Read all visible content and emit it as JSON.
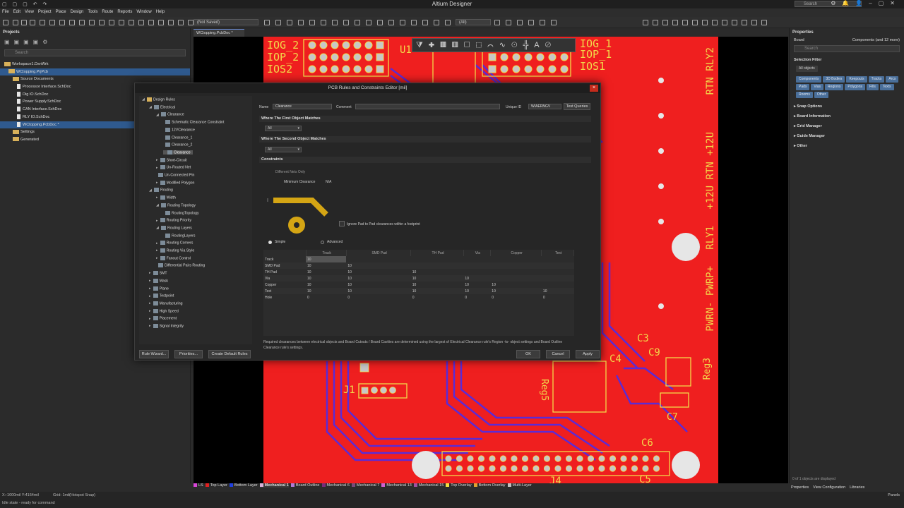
{
  "app": {
    "title": "Altium Designer",
    "search_placeholder": "Search"
  },
  "menu": [
    "File",
    "Edit",
    "View",
    "Project",
    "Place",
    "Design",
    "Tools",
    "Route",
    "Reports",
    "Window",
    "Help"
  ],
  "toolbar": {
    "saved_state": "(Not Saved)",
    "filter_value": "(All)"
  },
  "projects_panel": {
    "title": "Projects",
    "search_placeholder": "Search",
    "tree": [
      {
        "label": "Workspace1.DsnWrk",
        "indent": 0,
        "type": "workspace"
      },
      {
        "label": "WCtopping.PrjPcb",
        "indent": 1,
        "type": "project",
        "selected": true
      },
      {
        "label": "Source Documents",
        "indent": 2,
        "type": "folder"
      },
      {
        "label": "Processor Interface.SchDoc",
        "indent": 3,
        "type": "doc"
      },
      {
        "label": "Dig IO.SchDoc",
        "indent": 3,
        "type": "doc"
      },
      {
        "label": "Power Supply.SchDoc",
        "indent": 3,
        "type": "doc"
      },
      {
        "label": "CAN Interface.SchDoc",
        "indent": 3,
        "type": "doc"
      },
      {
        "label": "RLY IO.SchDoc",
        "indent": 3,
        "type": "doc"
      },
      {
        "label": "WCtopping.PcbDoc *",
        "indent": 3,
        "type": "doc",
        "selected": true
      },
      {
        "label": "Settings",
        "indent": 2,
        "type": "folder"
      },
      {
        "label": "Generated",
        "indent": 2,
        "type": "folder"
      }
    ]
  },
  "doc_tab": "WCtopping.PcbDoc *",
  "pcb_labels": {
    "iog2": "IOG_2",
    "iop2": "IOP_2",
    "ios2": "IOS2",
    "iog1": "IOG_1",
    "iop1": "IOP_1",
    "ios1": "IOS1",
    "u1": "U1",
    "rly2": "RTN RLY2",
    "p12": "+12U RTN +12U",
    "rly1": "RLY1",
    "pwrn": "PWRN- PWRP+",
    "c3": "C3",
    "c9": "C9",
    "c4": "C4",
    "reg3": "Reg3",
    "reg5": "Reg5",
    "c7": "C7",
    "j1": "J1",
    "c6": "C6",
    "c5": "C5",
    "j4": "J4"
  },
  "properties_panel": {
    "title": "Properties",
    "board_label": "Board",
    "components_info": "Components (and 12 more)",
    "search_placeholder": "Search",
    "selection_filter": "Selection Filter",
    "all_objects": "All objects",
    "filters": [
      "Components",
      "3D Bodies",
      "Keepouts",
      "Tracks",
      "Arcs",
      "Pads",
      "Vias",
      "Regions",
      "Polygons",
      "Fills",
      "Texts",
      "Rooms",
      "Other"
    ],
    "sections": [
      "Snap Options",
      "Board Information",
      "Grid Manager",
      "Guide Manager",
      "Other"
    ],
    "selection_status": "0 of 1 objects are displayed",
    "bottom_tabs": [
      "Properties",
      "View Configuration",
      "Libraries"
    ]
  },
  "dialog": {
    "title": "PCB Rules and Constraints Editor [mil]",
    "close": "×",
    "tree": [
      {
        "label": "Design Rules",
        "lvl": 0,
        "arrow": "◢"
      },
      {
        "label": "Electrical",
        "lvl": 1,
        "arrow": "◢"
      },
      {
        "label": "Clearance",
        "lvl": 2,
        "arrow": "◢"
      },
      {
        "label": "Schematic Clearance Constraint",
        "lvl": 3,
        "arrow": ""
      },
      {
        "label": "12VClearance",
        "lvl": 3,
        "arrow": ""
      },
      {
        "label": "Clearance_1",
        "lvl": 3,
        "arrow": ""
      },
      {
        "label": "Clearance_2",
        "lvl": 3,
        "arrow": ""
      },
      {
        "label": "Clearance",
        "lvl": 3,
        "arrow": "",
        "selected": true
      },
      {
        "label": "Short-Circuit",
        "lvl": 2,
        "arrow": "▸"
      },
      {
        "label": "Un-Routed Net",
        "lvl": 2,
        "arrow": "▸"
      },
      {
        "label": "Un-Connected Pin",
        "lvl": 2,
        "arrow": ""
      },
      {
        "label": "Modified Polygon",
        "lvl": 2,
        "arrow": "▸"
      },
      {
        "label": "Routing",
        "lvl": 1,
        "arrow": "◢"
      },
      {
        "label": "Width",
        "lvl": 2,
        "arrow": "▸"
      },
      {
        "label": "Routing Topology",
        "lvl": 2,
        "arrow": "◢"
      },
      {
        "label": "RoutingTopology",
        "lvl": 3,
        "arrow": ""
      },
      {
        "label": "Routing Priority",
        "lvl": 2,
        "arrow": "▸"
      },
      {
        "label": "Routing Layers",
        "lvl": 2,
        "arrow": "◢"
      },
      {
        "label": "RoutingLayers",
        "lvl": 3,
        "arrow": ""
      },
      {
        "label": "Routing Corners",
        "lvl": 2,
        "arrow": "▸"
      },
      {
        "label": "Routing Via Style",
        "lvl": 2,
        "arrow": "▸"
      },
      {
        "label": "Fanout Control",
        "lvl": 2,
        "arrow": "▸"
      },
      {
        "label": "Differential Pairs Routing",
        "lvl": 2,
        "arrow": ""
      },
      {
        "label": "SMT",
        "lvl": 1,
        "arrow": "▸"
      },
      {
        "label": "Mask",
        "lvl": 1,
        "arrow": "▸"
      },
      {
        "label": "Plane",
        "lvl": 1,
        "arrow": "▸"
      },
      {
        "label": "Testpoint",
        "lvl": 1,
        "arrow": "▸"
      },
      {
        "label": "Manufacturing",
        "lvl": 1,
        "arrow": "▸"
      },
      {
        "label": "High Speed",
        "lvl": 1,
        "arrow": "▸"
      },
      {
        "label": "Placement",
        "lvl": 1,
        "arrow": "▸"
      },
      {
        "label": "Signal Integrity",
        "lvl": 1,
        "arrow": "▸"
      }
    ],
    "name_label": "Name",
    "name_value": "Clearance",
    "comment_label": "Comment",
    "comment_value": "",
    "uid_label": "Unique ID",
    "uid_value": "WIAERNGV",
    "test_queries": "Test Queries",
    "first_match": "Where The First Object Matches",
    "first_value": "All",
    "second_match": "Where The Second Object Matches",
    "second_value": "All",
    "constraints": "Constraints",
    "different_nets": "Different Nets Only",
    "min_clearance": "Minimum Clearance",
    "min_clearance_value": "N/A",
    "ignore_pad": "Ignore Pad to Pad clearances within a footprint",
    "simple": "Simple",
    "advanced": "Advanced",
    "matrix_headers": [
      "Track",
      "SMD Pad",
      "TH Pad",
      "Via",
      "Copper",
      "Text"
    ],
    "matrix_rows": [
      {
        "name": "Track",
        "vals": [
          "10",
          "",
          "",
          "",
          "",
          ""
        ]
      },
      {
        "name": "SMD Pad",
        "vals": [
          "10",
          "10",
          "",
          "",
          "",
          ""
        ]
      },
      {
        "name": "TH Pad",
        "vals": [
          "10",
          "10",
          "10",
          "",
          "",
          ""
        ]
      },
      {
        "name": "Via",
        "vals": [
          "10",
          "10",
          "10",
          "10",
          "",
          ""
        ]
      },
      {
        "name": "Copper",
        "vals": [
          "10",
          "10",
          "10",
          "10",
          "10",
          ""
        ]
      },
      {
        "name": "Text",
        "vals": [
          "10",
          "10",
          "10",
          "10",
          "10",
          "10"
        ]
      },
      {
        "name": "Hole",
        "vals": [
          "0",
          "0",
          "0",
          "0",
          "0",
          "0"
        ]
      }
    ],
    "note": "Required clearances between electrical objects and Board Cutouts / Board Cavities are determined using the largest of Electrical Clearance rule's Region -to- object settings and Board Outline Clearance rule's settings.",
    "buttons": {
      "rule_wizard": "Rule Wizard...",
      "priorities": "Priorities...",
      "create_default": "Create Default Rules",
      "ok": "OK",
      "cancel": "Cancel",
      "apply": "Apply"
    }
  },
  "layers": [
    {
      "name": "LS",
      "color": "#d946d9"
    },
    {
      "name": "Top Layer",
      "color": "#e02020"
    },
    {
      "name": "Bottom Layer",
      "color": "#2040e0"
    },
    {
      "name": "Mechanical 1",
      "color": "#d9b0d9",
      "active": true
    },
    {
      "name": "Board Outline",
      "color": "#b07ad6"
    },
    {
      "name": "Mechanical 6",
      "color": "#7a2b7a"
    },
    {
      "name": "Mechanical 7",
      "color": "#7a4a7a"
    },
    {
      "name": "Mechanical 13",
      "color": "#d060d0"
    },
    {
      "name": "Mechanical 15",
      "color": "#a050a0"
    },
    {
      "name": "Top Overlay",
      "color": "#f0e040"
    },
    {
      "name": "Bottom Overlay",
      "color": "#e0a030"
    },
    {
      "name": "Multi-Layer",
      "color": "#c0c0c0"
    }
  ],
  "status": {
    "coords": "X:-1000mil Y:4164mil",
    "grid": "Grid: 1mil",
    "snap": "(Hotspot Snap)",
    "state": "Idle state - ready for command",
    "panels": "Panels"
  }
}
